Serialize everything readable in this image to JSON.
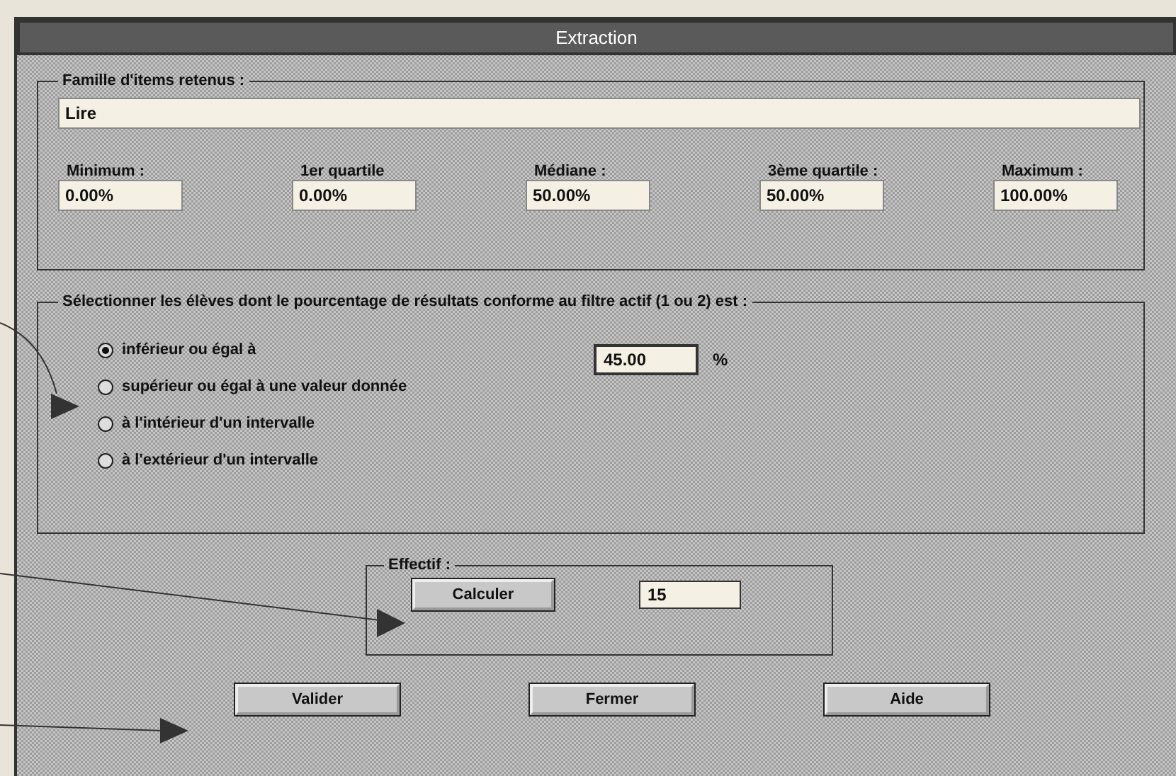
{
  "window": {
    "title": "Extraction"
  },
  "family_group": {
    "label": "Famille d'items retenus :",
    "value": "Lire"
  },
  "stats": [
    {
      "label": "Minimum :",
      "value": "0.00%"
    },
    {
      "label": "1er quartile",
      "value": "0.00%"
    },
    {
      "label": "Médiane :",
      "value": "50.00%"
    },
    {
      "label": "3ème quartile :",
      "value": "50.00%"
    },
    {
      "label": "Maximum :",
      "value": "100.00%"
    }
  ],
  "selection_group": {
    "label": "Sélectionner les élèves dont le pourcentage de résultats conforme au filtre actif (1 ou 2) est :",
    "value": "45.00",
    "unit": "%",
    "options": [
      {
        "label": "inférieur ou égal à",
        "selected": true
      },
      {
        "label": "supérieur ou égal à une valeur donnée",
        "selected": false
      },
      {
        "label": "à l'intérieur d'un intervalle",
        "selected": false
      },
      {
        "label": "à l'extérieur d'un intervalle",
        "selected": false
      }
    ]
  },
  "effectif": {
    "label": "Effectif :",
    "button": "Calculer",
    "value": "15"
  },
  "buttons": [
    "Valider",
    "Fermer",
    "Aide"
  ]
}
